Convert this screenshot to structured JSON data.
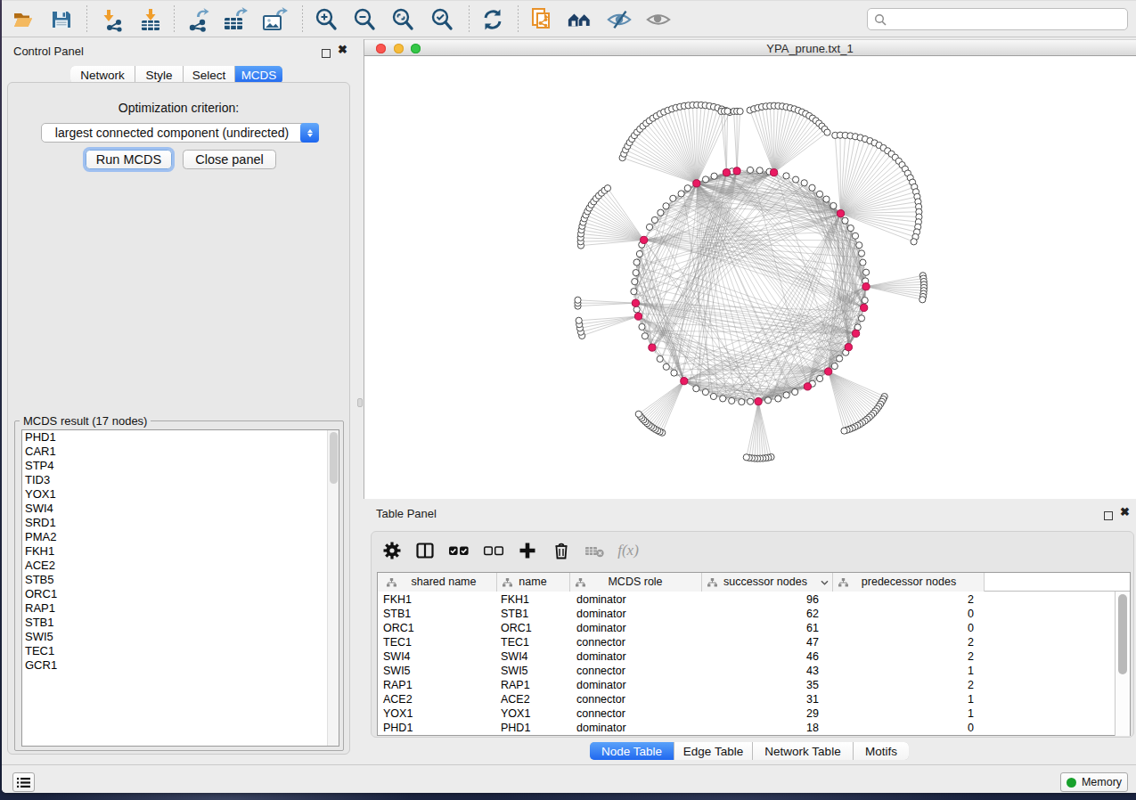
{
  "toolbar": {
    "buttons": [
      {
        "name": "open-session",
        "icon": "folder-open-icon"
      },
      {
        "name": "save-session",
        "icon": "save-icon"
      },
      {
        "name": "import-network",
        "icon": "import-network-icon"
      },
      {
        "name": "import-table",
        "icon": "import-table-icon"
      },
      {
        "name": "export-network",
        "icon": "export-network-icon"
      },
      {
        "name": "export-table",
        "icon": "export-table-icon"
      },
      {
        "name": "export-image",
        "icon": "export-image-icon"
      },
      {
        "name": "zoom-in",
        "icon": "zoom-in-icon"
      },
      {
        "name": "zoom-out",
        "icon": "zoom-out-icon"
      },
      {
        "name": "zoom-fit",
        "icon": "zoom-fit-icon"
      },
      {
        "name": "zoom-selected",
        "icon": "zoom-selected-icon"
      },
      {
        "name": "apply-layout",
        "icon": "refresh-icon"
      },
      {
        "name": "new-network-from-selection",
        "icon": "documents-share-icon"
      },
      {
        "name": "first-neighbors",
        "icon": "houses-icon"
      },
      {
        "name": "hide-selected",
        "icon": "eye-slash-icon"
      },
      {
        "name": "show-all",
        "icon": "eye-icon"
      }
    ],
    "search": {
      "placeholder": "",
      "value": ""
    }
  },
  "control_panel": {
    "title": "Control Panel",
    "tabs": [
      {
        "label": "Network",
        "selected": false
      },
      {
        "label": "Style",
        "selected": false
      },
      {
        "label": "Select",
        "selected": false
      },
      {
        "label": "MCDS",
        "selected": true
      }
    ],
    "optimization_label": "Optimization criterion:",
    "criterion_value": "largest connected component (undirected)",
    "run_button_label": "Run MCDS",
    "close_button_label": "Close panel",
    "result_group_title": "MCDS result (17 nodes)",
    "result_items": [
      "PHD1",
      "CAR1",
      "STP4",
      "TID3",
      "YOX1",
      "SWI4",
      "SRD1",
      "PMA2",
      "FKH1",
      "ACE2",
      "STB5",
      "ORC1",
      "RAP1",
      "STB1",
      "SWI5",
      "TEC1",
      "GCR1"
    ]
  },
  "network_window": {
    "title": "YPA_prune.txt_1"
  },
  "table_panel": {
    "title": "Table Panel",
    "toolbar_icons": [
      "gear-icon",
      "column-view-icon",
      "select-all-icon",
      "deselect-all-icon",
      "add-icon",
      "delete-icon",
      "clear-table-icon",
      "function-icon"
    ],
    "function_icon_text": "f(x)",
    "columns": [
      "shared name",
      "name",
      "MCDS role",
      "successor nodes",
      "predecessor nodes"
    ],
    "sorted_column": "successor nodes",
    "rows": [
      {
        "shared_name": "FKH1",
        "name": "FKH1",
        "role": "dominator",
        "succ": "96",
        "pred": "2"
      },
      {
        "shared_name": "STB1",
        "name": "STB1",
        "role": "dominator",
        "succ": "62",
        "pred": "0"
      },
      {
        "shared_name": "ORC1",
        "name": "ORC1",
        "role": "dominator",
        "succ": "61",
        "pred": "0"
      },
      {
        "shared_name": "TEC1",
        "name": "TEC1",
        "role": "connector",
        "succ": "47",
        "pred": "2"
      },
      {
        "shared_name": "SWI4",
        "name": "SWI4",
        "role": "dominator",
        "succ": "46",
        "pred": "2"
      },
      {
        "shared_name": "SWI5",
        "name": "SWI5",
        "role": "connector",
        "succ": "43",
        "pred": "1"
      },
      {
        "shared_name": "RAP1",
        "name": "RAP1",
        "role": "dominator",
        "succ": "35",
        "pred": "2"
      },
      {
        "shared_name": "ACE2",
        "name": "ACE2",
        "role": "connector",
        "succ": "31",
        "pred": "1"
      },
      {
        "shared_name": "YOX1",
        "name": "YOX1",
        "role": "connector",
        "succ": "29",
        "pred": "1"
      },
      {
        "shared_name": "PHD1",
        "name": "PHD1",
        "role": "dominator",
        "succ": "18",
        "pred": "0"
      }
    ],
    "tabs": [
      {
        "label": "Node Table",
        "selected": true
      },
      {
        "label": "Edge Table",
        "selected": false
      },
      {
        "label": "Network Table",
        "selected": false
      },
      {
        "label": "Motifs",
        "selected": false
      }
    ]
  },
  "status_bar": {
    "memory_label": "Memory",
    "memory_status_color": "#18a02c"
  },
  "chart_data": {
    "type": "network-circular",
    "description": "Circular layout of YPA_prune.txt_1 gene network; pink nodes are the 17 MCDS dominator/connector genes on the main ring, white leaf fans outside the ring are their private successors.",
    "center": [
      839,
      321
    ],
    "ring_radius": 130,
    "ring_positions": 78,
    "node_radius_white": 3.6,
    "node_radius_hub": 4.1,
    "colors": {
      "hub_fill": "#ea1a62",
      "hub_stroke": "#a70f45",
      "node_fill": "#ffffff",
      "node_stroke": "#4a4a4a",
      "fan_edge": "#b0b0b0",
      "chord_edge": "#8c8c8c"
    },
    "hubs": [
      {
        "angle": -117.6,
        "chords": 55
      },
      {
        "angle": -101.8,
        "chords": 8
      },
      {
        "angle": -96.6,
        "chords": 8
      },
      {
        "angle": -78.2,
        "chords": 18
      },
      {
        "angle": -38.7,
        "chords": 30
      },
      {
        "angle": 0.3,
        "chords": 22
      },
      {
        "angle": 10.8,
        "chords": 14
      },
      {
        "angle": 24.2,
        "chords": 12
      },
      {
        "angle": 31.9,
        "chords": 10
      },
      {
        "angle": 47.6,
        "chords": 18
      },
      {
        "angle": 60.3,
        "chords": 12
      },
      {
        "angle": 86.0,
        "chords": 18
      },
      {
        "angle": 124.8,
        "chords": 24
      },
      {
        "angle": 147.9,
        "chords": 10
      },
      {
        "angle": 164.8,
        "chords": 8
      },
      {
        "angle": 171.5,
        "chords": 8
      },
      {
        "angle": -156.6,
        "chords": 14
      }
    ],
    "fans": [
      {
        "hub": 0,
        "count": 32,
        "radius": 88,
        "a0": -161,
        "a1": -65
      },
      {
        "hub": 1,
        "count": 3,
        "radius": 69,
        "a0": -95,
        "a1": -89
      },
      {
        "hub": 2,
        "count": 3,
        "radius": 67,
        "a0": -93,
        "a1": -87
      },
      {
        "hub": 3,
        "count": 22,
        "radius": 75,
        "a0": -111,
        "a1": -37
      },
      {
        "hub": 4,
        "count": 32,
        "radius": 88,
        "a0": -94,
        "a1": 21
      },
      {
        "hub": 5,
        "count": 9,
        "radius": 65,
        "a0": -11,
        "a1": 13
      },
      {
        "hub": 9,
        "count": 20,
        "radius": 69,
        "a0": 24,
        "a1": 75
      },
      {
        "hub": 11,
        "count": 10,
        "radius": 64,
        "a0": 77,
        "a1": 102
      },
      {
        "hub": 12,
        "count": 13,
        "radius": 63,
        "a0": 113,
        "a1": 144
      },
      {
        "hub": 14,
        "count": 5,
        "radius": 67,
        "a0": 161,
        "a1": 176
      },
      {
        "hub": 15,
        "count": 3,
        "radius": 65,
        "a0": 177,
        "a1": 183
      },
      {
        "hub": 16,
        "count": 18,
        "radius": 71,
        "a0": -185,
        "a1": -125
      }
    ],
    "extra_chords": 40,
    "random_seed": 11
  }
}
